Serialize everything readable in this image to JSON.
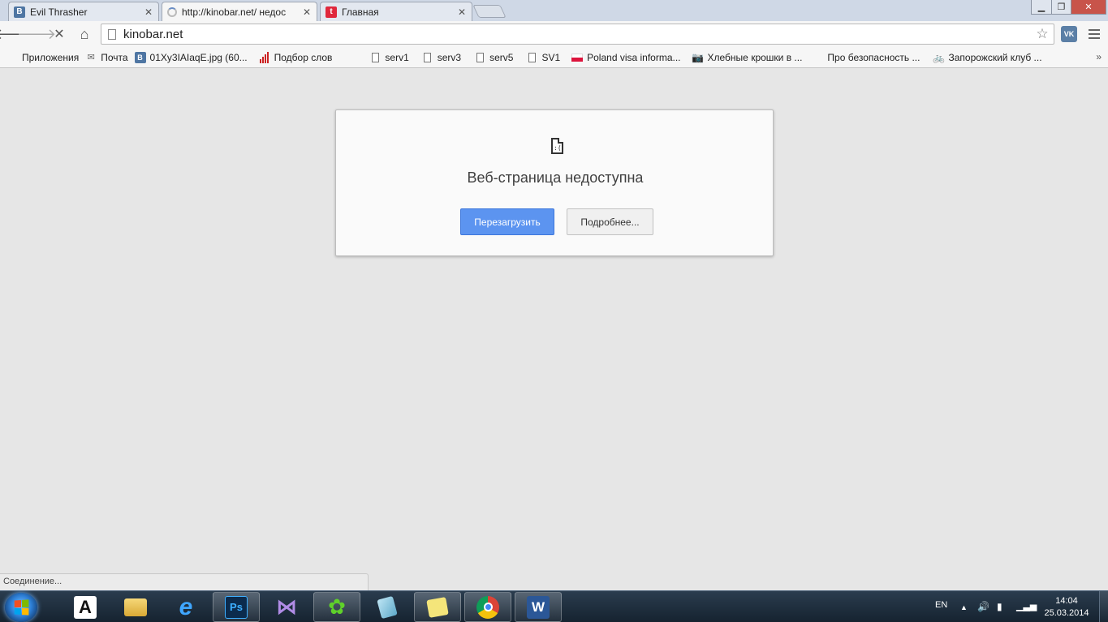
{
  "tabs": [
    {
      "title": "Evil Thrasher",
      "favicon": "vk-icon",
      "active": false
    },
    {
      "title": "http://kinobar.net/ недос",
      "favicon": "loading-spinner-icon",
      "active": true
    },
    {
      "title": "Главная",
      "favicon": "t-icon",
      "active": false
    }
  ],
  "omnibox": {
    "url": "kinobar.net"
  },
  "extension": {
    "label": "VK"
  },
  "bookmarks": [
    {
      "label": "Приложения",
      "icon": "apps-grid-icon"
    },
    {
      "label": "Почта",
      "icon": "mail-icon"
    },
    {
      "label": "01Xy3IAIaqE.jpg (60...",
      "icon": "vk-icon"
    },
    {
      "label": "Подбор слов",
      "icon": "bar-chart-icon"
    },
    {
      "label": "serv1",
      "icon": "page-icon"
    },
    {
      "label": "serv3",
      "icon": "page-icon"
    },
    {
      "label": "serv5",
      "icon": "page-icon"
    },
    {
      "label": "SV1",
      "icon": "page-icon"
    },
    {
      "label": "Poland visa informa...",
      "icon": "poland-flag-icon"
    },
    {
      "label": "Хлебные крошки в ...",
      "icon": "camera-icon"
    },
    {
      "label": "Про безопасность ...",
      "icon": "ukraine-flag-icon"
    },
    {
      "label": "Запорожский клуб ...",
      "icon": "bicycle-icon"
    }
  ],
  "bookmarks_more": "»",
  "error": {
    "title": "Веб-страница недоступна",
    "reload_label": "Перезагрузить",
    "details_label": "Подробнее..."
  },
  "status": {
    "text": "Соединение..."
  },
  "taskbar": {
    "apps": [
      {
        "name": "abbyy-icon",
        "glyph": "A"
      },
      {
        "name": "explorer-folder-icon",
        "glyph": ""
      },
      {
        "name": "internet-explorer-icon",
        "glyph": "e"
      },
      {
        "name": "photoshop-icon",
        "glyph": "Ps"
      },
      {
        "name": "visual-studio-icon",
        "glyph": "⋈"
      },
      {
        "name": "icq-icon",
        "glyph": "✿"
      },
      {
        "name": "notes-app-icon",
        "glyph": ""
      },
      {
        "name": "sticky-notes-icon",
        "glyph": ""
      },
      {
        "name": "chrome-icon",
        "glyph": ""
      },
      {
        "name": "word-icon",
        "glyph": "W"
      }
    ],
    "lang": "EN",
    "time": "14:04",
    "date": "25.03.2014"
  },
  "colors": {
    "accent_button": "#5c94f0",
    "tab_strip": "#cfd8e6",
    "taskbar": "#1e2f40"
  }
}
